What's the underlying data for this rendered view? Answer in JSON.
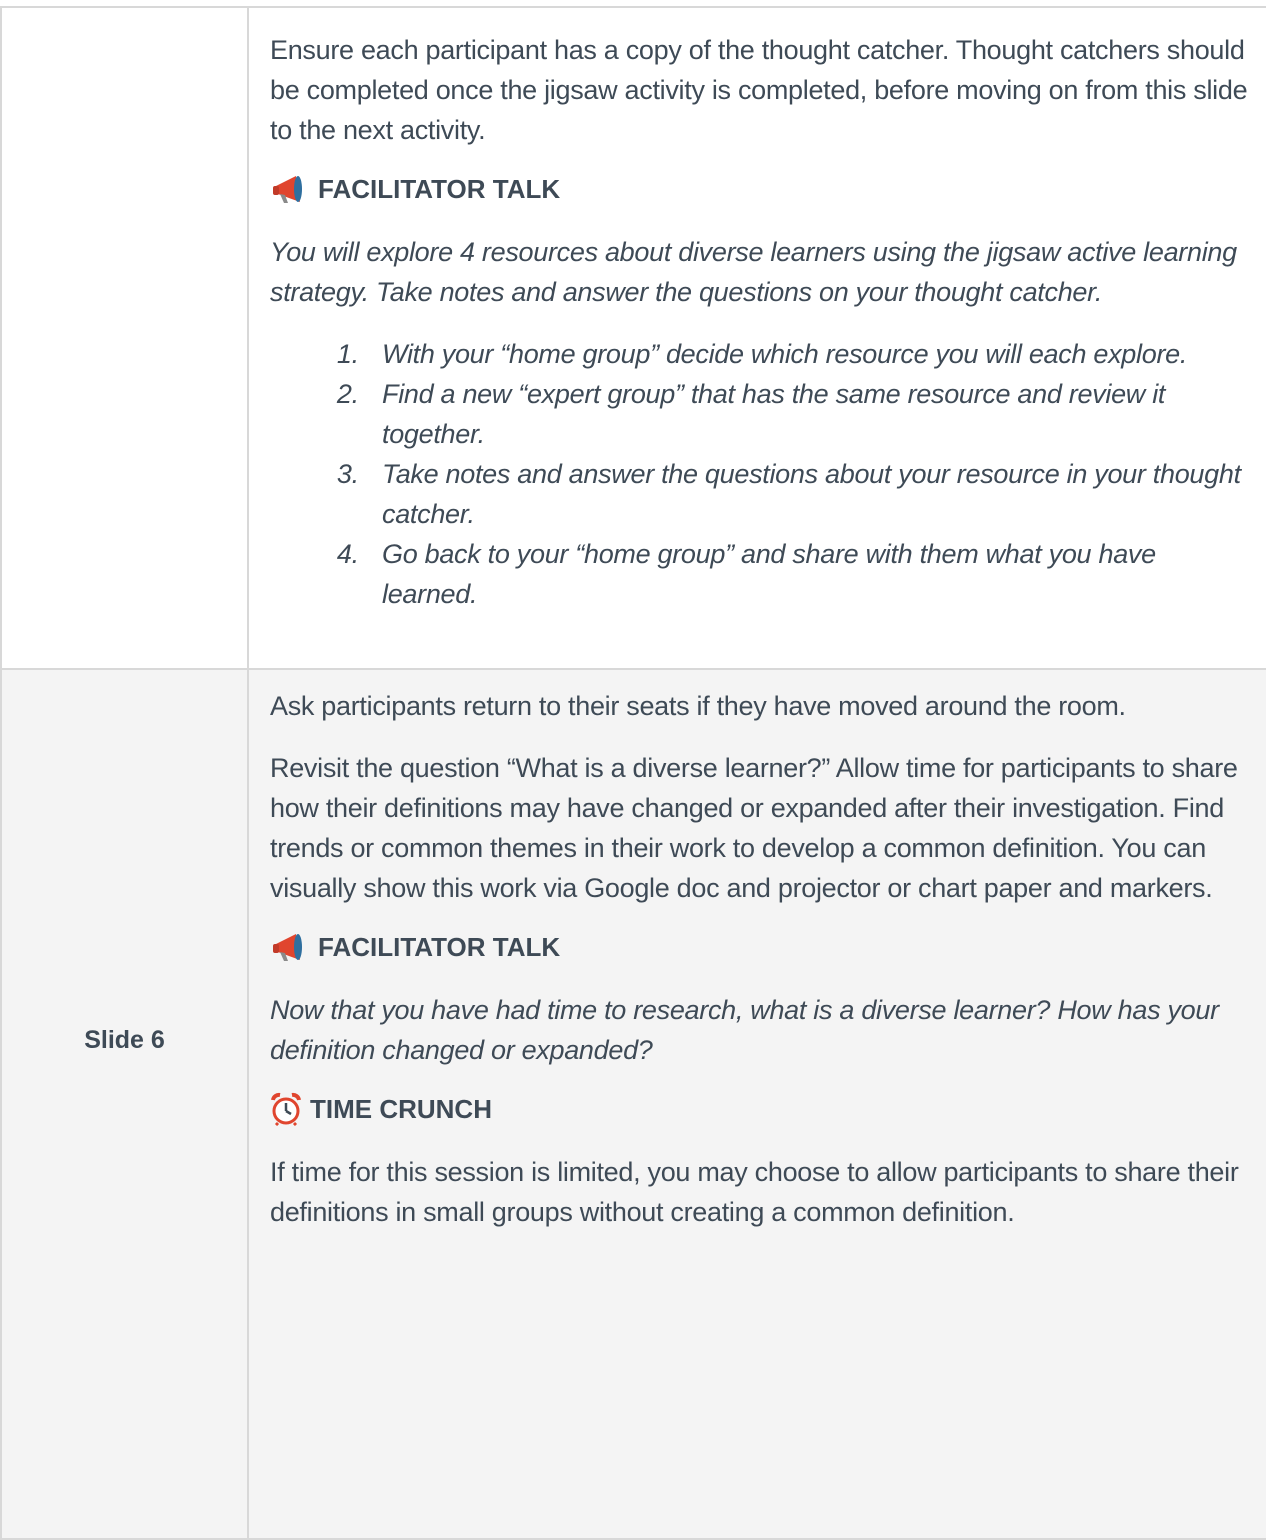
{
  "rows": [
    {
      "slide_label": "",
      "intro": "Ensure each participant has a copy of the thought catcher. Thought catchers should be completed once the jigsaw activity is completed, before moving on from this slide to the next activity.",
      "talk_heading": "FACILITATOR TALK",
      "talk_text": "You will explore 4 resources about diverse learners using the jigsaw active learning strategy. Take notes and answer the questions on your thought catcher.",
      "steps": [
        "With your “home group” decide which resource you will each explore.",
        "Find a new “expert group” that has the same resource and review it together.",
        "Take notes and answer the questions about your resource in your thought catcher.",
        "Go back to your “home group” and share with them what you have learned."
      ]
    },
    {
      "slide_label": "Slide 6",
      "para1": "Ask participants return to their seats if they have moved around the room.",
      "para2": "Revisit the question “What is a diverse learner?” Allow time for participants to share how their definitions may have changed or expanded after their investigation. Find trends or common themes in their work to develop a common definition. You can visually show this work via Google doc and projector or chart paper and markers.",
      "talk_heading": "FACILITATOR TALK",
      "talk_text": "Now that you have had time to research, what is a diverse learner? How has your definition changed or expanded?",
      "crunch_heading": "TIME CRUNCH",
      "crunch_text": "If time for this session is limited, you may choose to allow participants to share their definitions in small groups without creating a common definition."
    }
  ],
  "icons": {
    "facilitator": "megaphone-icon",
    "time_crunch": "alarm-clock-icon"
  },
  "colors": {
    "text": "#3e4a56",
    "shaded_row": "#f4f4f4",
    "border": "#d8d8d8",
    "megaphone": "#e0452e",
    "clock": "#e0452e"
  }
}
